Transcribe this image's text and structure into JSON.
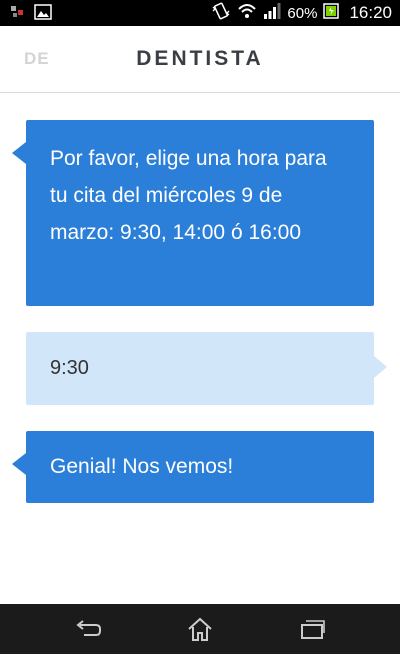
{
  "status_bar": {
    "battery_percent": "60%",
    "time": "16:20",
    "icons": [
      "notification-icon",
      "image-icon",
      "vibrate-icon",
      "wifi-icon",
      "signal-icon",
      "battery-icon"
    ]
  },
  "header": {
    "back_label": "DE",
    "title": "DENTISTA"
  },
  "messages": [
    {
      "sender": "bot",
      "text": "Por favor, elige una hora para tu cita del miércoles 9 de marzo: 9:30, 14:00 ó 16:00"
    },
    {
      "sender": "user",
      "text": "9:30"
    },
    {
      "sender": "bot",
      "text": "Genial! Nos vemos!"
    }
  ],
  "colors": {
    "bot_bubble": "#2b7fd8",
    "user_bubble": "#d2e6fa",
    "header_text": "#3b3f45"
  },
  "nav_bar": {
    "buttons": [
      "back-icon",
      "home-icon",
      "recent-apps-icon"
    ]
  }
}
